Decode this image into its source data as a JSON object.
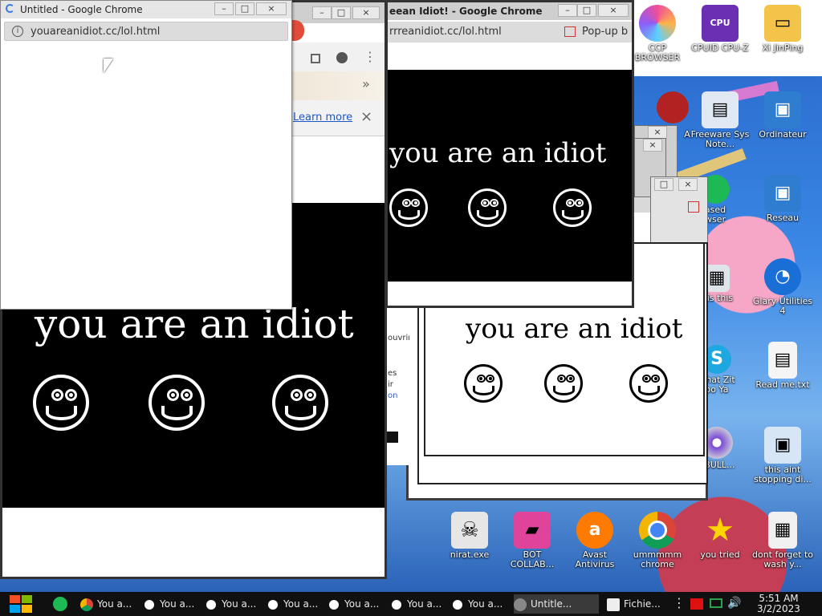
{
  "desktop_icons": [
    {
      "label": "CCP BROWSER",
      "icon": "ccp-browser-icon",
      "color": "#f04e98"
    },
    {
      "label": "CPUID CPU-Z",
      "icon": "cpu-z-icon",
      "color": "#6b2fb3"
    },
    {
      "label": "Xi JinPing",
      "icon": "folder-user-icon",
      "color": "#f3c34a"
    },
    {
      "label": "A",
      "icon": "shortcut-icon",
      "color": "#b22222"
    },
    {
      "label": "Freeware Sys Note...",
      "icon": "document-icon",
      "color": "#dfe8f3"
    },
    {
      "label": "Ordinateur",
      "icon": "computer-icon",
      "color": "#2e7dd1"
    },
    {
      "label": "Reseau",
      "icon": "network-icon",
      "color": "#2e7dd1"
    },
    {
      "label": "ased wser",
      "icon": "browser-icon",
      "color": "#1db954"
    },
    {
      "label": "t is this",
      "icon": "calculator-icon",
      "color": "#dfe3ea"
    },
    {
      "label": "Glary Utilities 4",
      "icon": "glary-icon",
      "color": "#1a6fd6"
    },
    {
      "label": "what Zit oo Ya",
      "icon": "skype-icon",
      "color": "#1ea7e1"
    },
    {
      "label": "Read me.txt",
      "icon": "text-file-icon",
      "color": "#f5f5f5"
    },
    {
      "label": "aBULL...",
      "icon": "disc-icon",
      "color": "#c8c8d8"
    },
    {
      "label": "this aint stopping di...",
      "icon": "installer-icon",
      "color": "#d7e6f7"
    },
    {
      "label": "nirat.exe",
      "icon": "skull-icon",
      "color": "#e6e6e6"
    },
    {
      "label": "BOT COLLAB...",
      "icon": "bot-collab-icon",
      "color": "#e0439a"
    },
    {
      "label": "Avast Antivirus",
      "icon": "avast-icon",
      "color": "#ff7a00"
    },
    {
      "label": "ummmmm chrome",
      "icon": "chrome-icon",
      "color": "#4285f4"
    },
    {
      "label": "you tried",
      "icon": "star-icon",
      "color": "#ffd400"
    },
    {
      "label": "dont forget to wash y...",
      "icon": "calendar-file-icon",
      "color": "#f0f0f0"
    }
  ],
  "popup_front": {
    "title": "Untitled - Google Chrome",
    "url": "youareanidiot.cc/lol.html"
  },
  "main_window": {
    "learn_more": "Learn more",
    "chevron": "»",
    "message": "you are an idiot"
  },
  "popup_top_right": {
    "title": "eean Idiot! - Google Chrome",
    "url": "rrreanidiot.cc/lol.html",
    "popup_label": "Pop-up b",
    "message": "you are an idiot"
  },
  "popup_mid": {
    "message": "you are an idiot"
  },
  "background_fragments": {
    "text1": "ouvrir",
    "text2": "es",
    "text3": "ir",
    "text4": "on"
  },
  "window_controls": {
    "minimize": "–",
    "maximize": "□",
    "close": "×"
  },
  "taskbar": {
    "tasks": [
      {
        "label": "You a...",
        "icon": "chrome-icon"
      },
      {
        "label": "You a...",
        "icon": "smiley-icon"
      },
      {
        "label": "You a...",
        "icon": "smiley-icon"
      },
      {
        "label": "You a...",
        "icon": "smiley-icon"
      },
      {
        "label": "You a...",
        "icon": "smiley-icon"
      },
      {
        "label": "You a...",
        "icon": "smiley-icon"
      },
      {
        "label": "You a...",
        "icon": "smiley-icon"
      },
      {
        "label": "Untitle...",
        "icon": "chrome-gray-icon"
      },
      {
        "label": "Fichie...",
        "icon": "folder-window-icon"
      }
    ],
    "time": "5:51 AM",
    "date": "3/2/2023"
  }
}
